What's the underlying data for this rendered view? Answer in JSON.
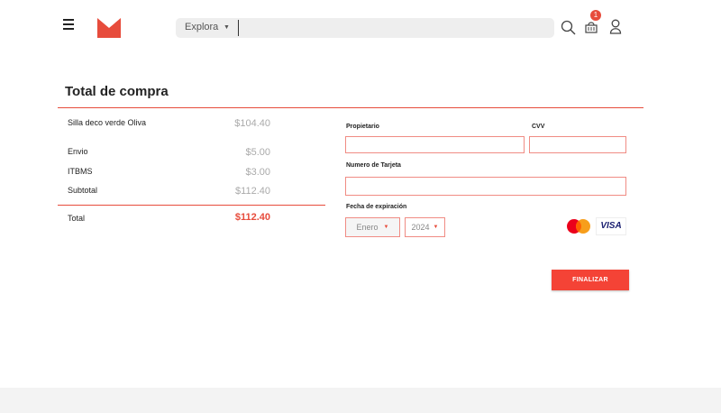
{
  "header": {
    "explora_label": "Explora",
    "search_placeholder": "",
    "cart_count": "1",
    "brand_color": "#e74c3c"
  },
  "summary": {
    "title": "Total de compra",
    "items": [
      {
        "label": "Silla deco verde Oliva",
        "price": "$104.40"
      },
      {
        "label": "Envio",
        "price": "$5.00"
      },
      {
        "label": "ITBMS",
        "price": "$3.00"
      },
      {
        "label": "Subtotal",
        "price": "$112.40"
      }
    ],
    "total_label": "Total",
    "total_value": "$112.40"
  },
  "payment": {
    "owner_label": "Propietario",
    "cvv_label": "CVV",
    "card_label": "Numero de Tarjeta",
    "expiry_label": "Fecha de expiración",
    "month_value": "Enero",
    "year_value": "2024",
    "visa_text": "VISA",
    "mastercard_text": "MasterCard",
    "submit_label": "FINALIZAR"
  },
  "icons": [
    "menu-icon",
    "brand-logo",
    "search-icon",
    "cart-icon",
    "user-icon",
    "chevron-down-icon"
  ]
}
